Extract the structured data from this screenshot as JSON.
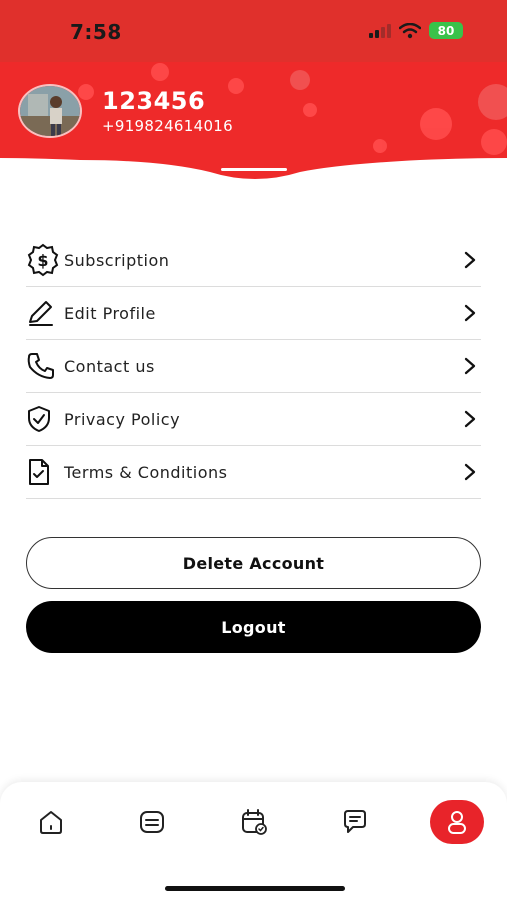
{
  "status_bar": {
    "time": "7:58",
    "battery": "80"
  },
  "colors": {
    "brand_red": "#e8242a",
    "dark_button": "#000000"
  },
  "profile": {
    "name": "123456",
    "phone": "+919824614016"
  },
  "menu": {
    "items": [
      {
        "label": "Subscription",
        "icon": "dollar-badge-icon"
      },
      {
        "label": "Edit Profile",
        "icon": "pen-icon"
      },
      {
        "label": "Contact us",
        "icon": "phone-icon"
      },
      {
        "label": "Privacy Policy",
        "icon": "shield-check-icon"
      },
      {
        "label": "Terms & Conditions",
        "icon": "document-check-icon"
      }
    ]
  },
  "actions": {
    "delete_label": "Delete Account",
    "logout_label": "Logout"
  },
  "bottom_nav": {
    "items": [
      {
        "icon": "home-icon"
      },
      {
        "icon": "list-icon"
      },
      {
        "icon": "calendar-icon"
      },
      {
        "icon": "chat-icon"
      },
      {
        "icon": "profile-icon",
        "active": true
      }
    ]
  }
}
